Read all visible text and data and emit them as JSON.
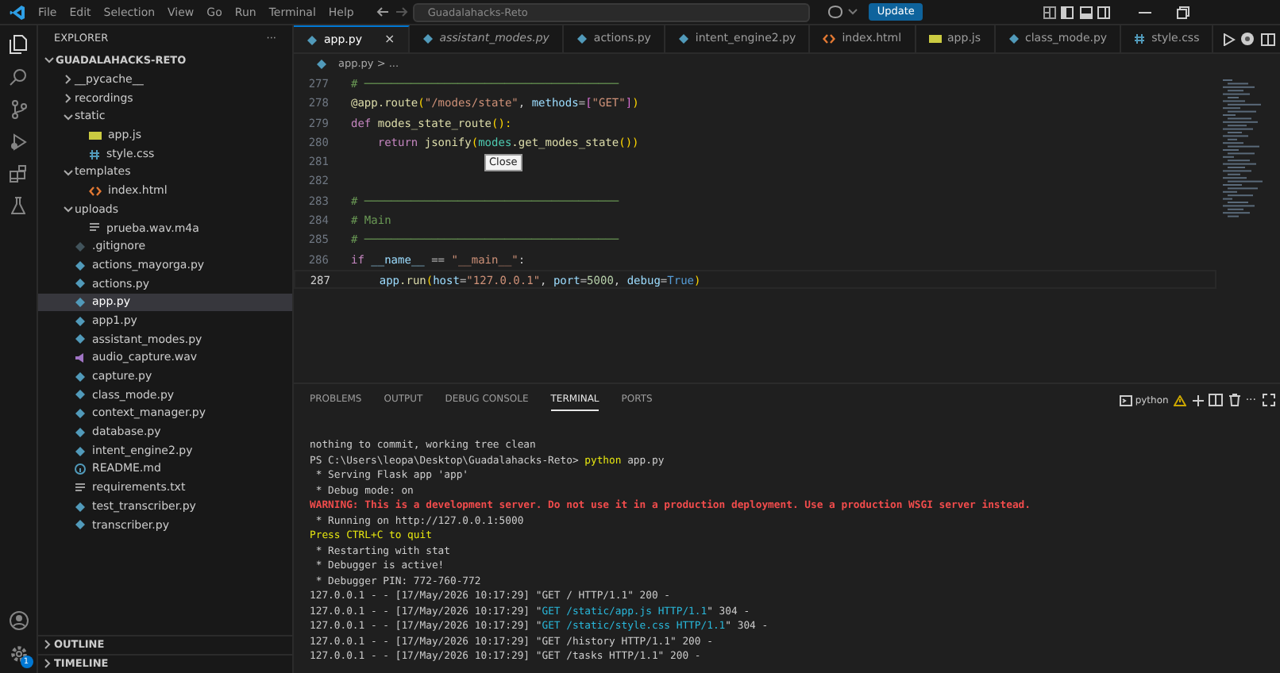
{
  "title_bar": {
    "menu": [
      "File",
      "Edit",
      "Selection",
      "View",
      "Go",
      "Run",
      "Terminal",
      "Help"
    ],
    "search": "Guadalahacks-Reto",
    "update_button": "Update"
  },
  "sidebar": {
    "title": "EXPLORER",
    "more": "···",
    "root": "GUADALAHACKS-RETO",
    "items": [
      {
        "label": "__pycache__",
        "kind": "folder",
        "expanded": false,
        "selected": false
      },
      {
        "label": "recordings",
        "kind": "folder",
        "expanded": false,
        "selected": false
      },
      {
        "label": "static",
        "kind": "folder",
        "expanded": true,
        "selected": false,
        "children": [
          {
            "label": "app.js",
            "kind": "js",
            "selected": false
          },
          {
            "label": "style.css",
            "kind": "css",
            "selected": false
          }
        ]
      },
      {
        "label": "templates",
        "kind": "folder",
        "expanded": true,
        "selected": false,
        "children": [
          {
            "label": "index.html",
            "kind": "html",
            "selected": false
          }
        ]
      },
      {
        "label": "uploads",
        "kind": "folder",
        "expanded": true,
        "selected": false,
        "children": [
          {
            "label": "prueba.wav.m4a",
            "kind": "text",
            "selected": false
          }
        ]
      },
      {
        "label": ".gitignore",
        "kind": "git",
        "selected": false
      },
      {
        "label": "actions_mayorga.py",
        "kind": "py",
        "selected": false
      },
      {
        "label": "actions.py",
        "kind": "py",
        "selected": false
      },
      {
        "label": "app.py",
        "kind": "py",
        "selected": true
      },
      {
        "label": "app1.py",
        "kind": "py",
        "selected": false
      },
      {
        "label": "assistant_modes.py",
        "kind": "py",
        "selected": false
      },
      {
        "label": "audio_capture.wav",
        "kind": "audio",
        "selected": false
      },
      {
        "label": "capture.py",
        "kind": "py",
        "selected": false
      },
      {
        "label": "class_mode.py",
        "kind": "py",
        "selected": false
      },
      {
        "label": "context_manager.py",
        "kind": "py",
        "selected": false
      },
      {
        "label": "database.py",
        "kind": "py",
        "selected": false
      },
      {
        "label": "intent_engine2.py",
        "kind": "py",
        "selected": false
      },
      {
        "label": "README.md",
        "kind": "info",
        "selected": false
      },
      {
        "label": "requirements.txt",
        "kind": "text",
        "selected": false
      },
      {
        "label": "test_transcriber.py",
        "kind": "py",
        "selected": false
      },
      {
        "label": "transcriber.py",
        "kind": "py",
        "selected": false
      }
    ],
    "sections": [
      {
        "label": "OUTLINE",
        "expanded": false
      },
      {
        "label": "TIMELINE",
        "expanded": false
      }
    ]
  },
  "tabs": [
    {
      "label": "app.py",
      "kind": "py",
      "selected": true,
      "italic": false,
      "close": "×"
    },
    {
      "label": "assistant_modes.py",
      "kind": "py",
      "selected": false,
      "italic": true
    },
    {
      "label": "actions.py",
      "kind": "py",
      "selected": false,
      "italic": false
    },
    {
      "label": "intent_engine2.py",
      "kind": "py",
      "selected": false,
      "italic": false
    },
    {
      "label": "index.html",
      "kind": "html",
      "selected": false,
      "italic": false
    },
    {
      "label": "app.js",
      "kind": "js",
      "selected": false,
      "italic": false
    },
    {
      "label": "class_mode.py",
      "kind": "py",
      "selected": false,
      "italic": false
    },
    {
      "label": "style.css",
      "kind": "css",
      "selected": false,
      "italic": false
    }
  ],
  "breadcrumb": "app.py > ...",
  "code": [
    {
      "n": "277",
      "segs": [
        {
          "t": "# ──────────────────────────────────────",
          "kind": "comment"
        }
      ]
    },
    {
      "n": "278",
      "segs": [
        {
          "t": "@app.route",
          "kind": "deco"
        },
        {
          "t": "(",
          "kind": "brace"
        },
        {
          "t": "\"/modes/state\"",
          "kind": "string"
        },
        {
          "t": ", ",
          "kind": "plain"
        },
        {
          "t": "methods",
          "kind": "param"
        },
        {
          "t": "=",
          "kind": "plain"
        },
        {
          "t": "[",
          "kind": "brace2"
        },
        {
          "t": "\"GET\"",
          "kind": "string"
        },
        {
          "t": "]",
          "kind": "brace2"
        },
        {
          "t": ")",
          "kind": "brace"
        }
      ]
    },
    {
      "n": "279",
      "segs": [
        {
          "t": "def ",
          "kind": "keyword"
        },
        {
          "t": "modes_state_route",
          "kind": "func"
        },
        {
          "t": "():",
          "kind": "brace"
        }
      ]
    },
    {
      "n": "280",
      "segs": [
        {
          "t": "    return ",
          "kind": "keyword"
        },
        {
          "t": "jsonify",
          "kind": "func"
        },
        {
          "t": "(",
          "kind": "brace"
        },
        {
          "t": "modes",
          "kind": "module"
        },
        {
          "t": ".get_modes_state",
          "kind": "func"
        },
        {
          "t": "())",
          "kind": "brace"
        }
      ]
    },
    {
      "n": "281"
    },
    {
      "n": "282"
    },
    {
      "n": "283",
      "segs": [
        {
          "t": "# ──────────────────────────────────────",
          "kind": "comment"
        }
      ]
    },
    {
      "n": "284",
      "segs": [
        {
          "t": "# Main",
          "kind": "comment"
        }
      ]
    },
    {
      "n": "285",
      "segs": [
        {
          "t": "# ──────────────────────────────────────",
          "kind": "comment"
        }
      ]
    },
    {
      "n": "286",
      "segs": [
        {
          "t": "if ",
          "kind": "keyword"
        },
        {
          "t": "__name__",
          "kind": "var"
        },
        {
          "t": " == ",
          "kind": "plain"
        },
        {
          "t": "\"__main__\"",
          "kind": "string"
        },
        {
          "t": ":",
          "kind": "plain"
        }
      ]
    },
    {
      "n": "287",
      "segs": [
        {
          "t": "    app",
          "kind": "var"
        },
        {
          "t": ".run",
          "kind": "func"
        },
        {
          "t": "(",
          "kind": "brace"
        },
        {
          "t": "host",
          "kind": "param"
        },
        {
          "t": "=",
          "kind": "plain"
        },
        {
          "t": "\"127.0.0.1\"",
          "kind": "string"
        },
        {
          "t": ", ",
          "kind": "plain"
        },
        {
          "t": "port",
          "kind": "param"
        },
        {
          "t": "=",
          "kind": "plain"
        },
        {
          "t": "5000",
          "kind": "number"
        },
        {
          "t": ", ",
          "kind": "plain"
        },
        {
          "t": "debug",
          "kind": "param"
        },
        {
          "t": "=",
          "kind": "plain"
        },
        {
          "t": "True",
          "kind": "bool"
        },
        {
          "t": ")",
          "kind": "brace"
        }
      ]
    }
  ],
  "tooltip": "Close",
  "panel": {
    "tabs": [
      {
        "label": "PROBLEMS",
        "selected": false
      },
      {
        "label": "OUTPUT",
        "selected": false
      },
      {
        "label": "DEBUG CONSOLE",
        "selected": false
      },
      {
        "label": "TERMINAL",
        "selected": true
      },
      {
        "label": "PORTS",
        "selected": false
      }
    ],
    "shell": "python",
    "more": "···",
    "lines": [
      [
        {
          "t": "nothing to commit, working tree clean",
          "kind": "plain"
        }
      ],
      [
        {
          "t": "PS C:\\Users\\leopa\\Desktop\\Guadalahacks-Reto> ",
          "kind": "plain"
        },
        {
          "t": "python",
          "kind": "yellow"
        },
        {
          "t": " app.py",
          "kind": "plain"
        }
      ],
      [
        {
          "t": " * Serving Flask app 'app'",
          "kind": "plain"
        }
      ],
      [
        {
          "t": " * Debug mode: on",
          "kind": "plain"
        }
      ],
      [
        {
          "t": "WARNING: This is a development server. Do not use it in a production deployment. Use a production WSGI server instead.",
          "kind": "red"
        }
      ],
      [
        {
          "t": " * Running on http://127.0.0.1:5000",
          "kind": "plain"
        }
      ],
      [
        {
          "t": "Press CTRL+C to quit",
          "kind": "yellow"
        }
      ],
      [
        {
          "t": " * Restarting with stat",
          "kind": "plain"
        }
      ],
      [
        {
          "t": " * Debugger is active!",
          "kind": "plain"
        }
      ],
      [
        {
          "t": " * Debugger PIN: 772-760-772",
          "kind": "plain"
        }
      ],
      [
        {
          "t": "127.0.0.1 - - [17/May/2026 10:17:29] \"GET / HTTP/1.1\" 200 -",
          "kind": "plain"
        }
      ],
      [
        {
          "t": "127.0.0.1 - - [17/May/2026 10:17:29] \"",
          "kind": "plain"
        },
        {
          "t": "GET /static/app.js HTTP/1.1",
          "kind": "cyan"
        },
        {
          "t": "\" 304 -",
          "kind": "plain"
        }
      ],
      [
        {
          "t": "127.0.0.1 - - [17/May/2026 10:17:29] \"",
          "kind": "plain"
        },
        {
          "t": "GET /static/style.css HTTP/1.1",
          "kind": "cyan"
        },
        {
          "t": "\" 304 -",
          "kind": "plain"
        }
      ],
      [
        {
          "t": "127.0.0.1 - - [17/May/2026 10:17:29] \"GET /history HTTP/1.1\" 200 -",
          "kind": "plain"
        }
      ],
      [
        {
          "t": "127.0.0.1 - - [17/May/2026 10:17:29] \"GET /tasks HTTP/1.1\" 200 -",
          "kind": "plain"
        }
      ]
    ]
  },
  "account_badge": "1"
}
